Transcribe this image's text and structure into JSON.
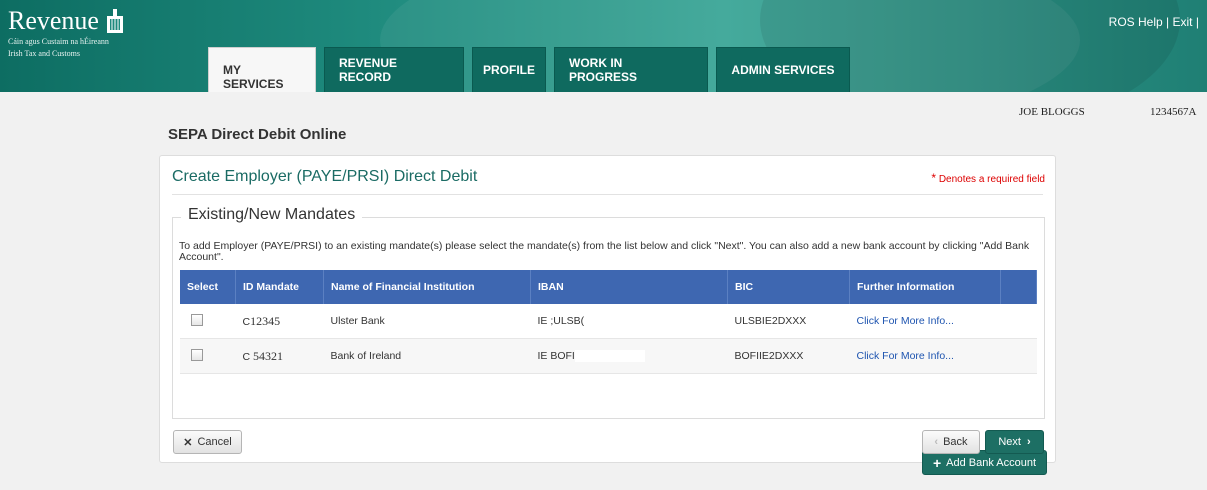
{
  "header": {
    "brand": "Revenue",
    "brand_sub1": "Cáin agus Custaim na hÉireann",
    "brand_sub2": "Irish Tax and Customs",
    "links": {
      "help": "ROS Help",
      "separator": "|",
      "exit": "Exit",
      "trailing": "|"
    }
  },
  "tabs": [
    {
      "label": "MY SERVICES",
      "active": true
    },
    {
      "label": "REVENUE RECORD"
    },
    {
      "label": "PROFILE"
    },
    {
      "label": "WORK IN PROGRESS"
    },
    {
      "label": "ADMIN SERVICES"
    }
  ],
  "user": {
    "name": "JOE BLOGGS",
    "id": "1234567A"
  },
  "page": {
    "title": "SEPA Direct Debit Online"
  },
  "form": {
    "title": "Create Employer (PAYE/PRSI) Direct Debit",
    "required_star": "*",
    "required_note": "Denotes a required field",
    "section_title": "Existing/New Mandates",
    "instructions": "To add Employer (PAYE/PRSI) to an existing mandate(s) please select the mandate(s) from the list below and click \"Next\". You can also add a new bank account by clicking \"Add Bank Account\".",
    "columns": [
      "Select",
      "ID Mandate",
      "Name of Financial Institution",
      "IBAN",
      "BIC",
      "Further Information"
    ],
    "rows": [
      {
        "id_prefix": "C",
        "id_number": "12345",
        "institution": "Ulster Bank",
        "iban": "IE  ;ULSB(",
        "bic": "ULSBIE2DXXX",
        "info": "Click For More Info..."
      },
      {
        "id_prefix": "C",
        "id_number": "54321",
        "institution": "Bank of Ireland",
        "iban": "IE   BOFI",
        "bic": "BOFIIE2DXXX",
        "info": "Click For More Info..."
      }
    ],
    "buttons": {
      "add_bank": "Add Bank Account",
      "cancel": "Cancel",
      "back": "Back",
      "next": "Next"
    }
  },
  "colors": {
    "header": "#1e8a7d",
    "accent": "#1d6f64",
    "table_header": "#3e67b1",
    "link": "#1f55b0",
    "required": "#dd0000"
  }
}
